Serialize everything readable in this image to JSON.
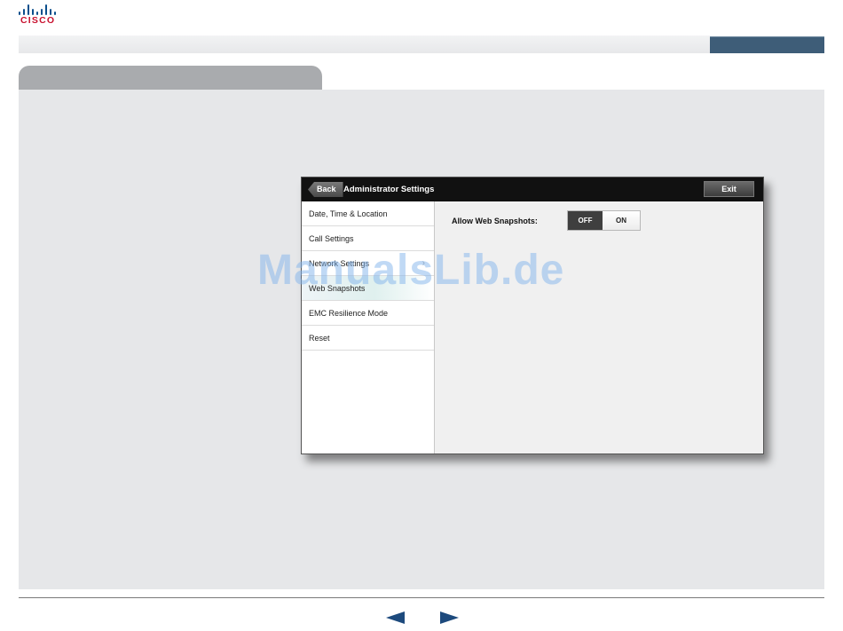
{
  "logo": {
    "text": "CISCO",
    "icon": "cisco-bridge-icon",
    "color": "#c8102e",
    "bar_color": "#0b4f8c"
  },
  "topbar": {
    "active_color": "#3e5d78"
  },
  "device": {
    "back_label": "Back",
    "title": "Administrator Settings",
    "exit_label": "Exit",
    "menu": [
      {
        "label": "Date, Time & Location"
      },
      {
        "label": "Call Settings"
      },
      {
        "label": "Network Settings"
      },
      {
        "label": "Web Snapshots",
        "selected": true
      },
      {
        "label": "EMC Resilience Mode"
      },
      {
        "label": "Reset"
      }
    ],
    "setting": {
      "label": "Allow Web Snapshots:",
      "off_label": "OFF",
      "on_label": "ON",
      "value": "OFF"
    }
  },
  "watermark": "ManualsLib.de",
  "footer": {
    "prev_icon": "triangle-left-icon",
    "next_icon": "triangle-right-icon",
    "arrow_color": "#1d4a7d"
  }
}
